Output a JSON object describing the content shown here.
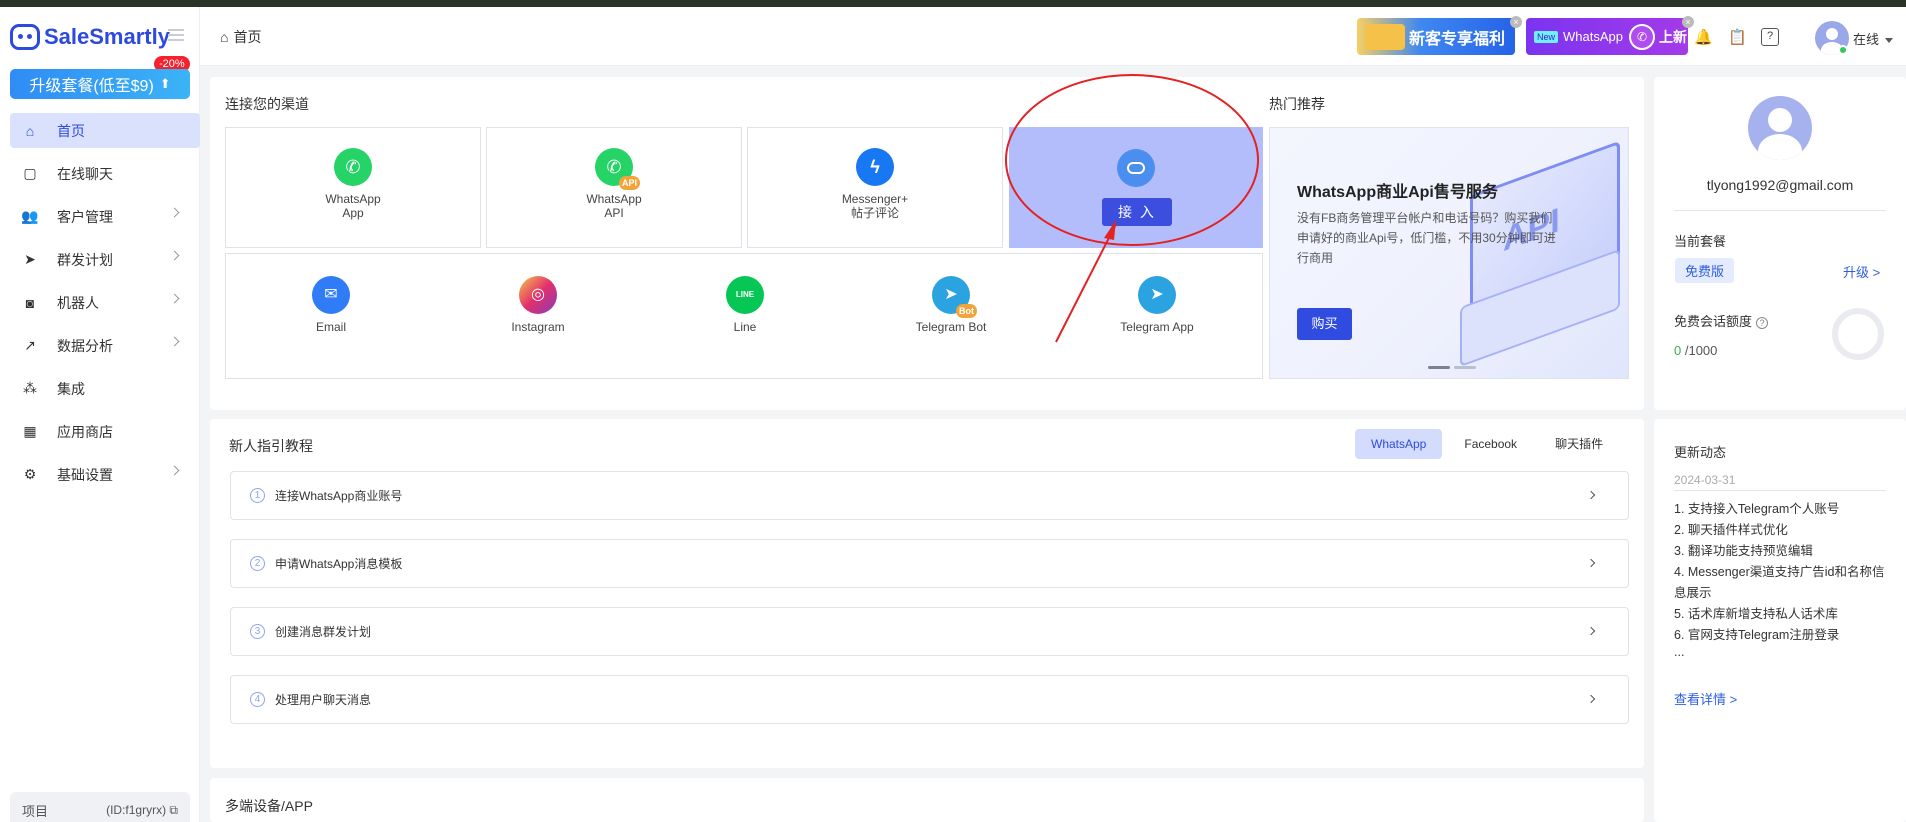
{
  "brand": {
    "name": "SaleSmartly"
  },
  "sidebar": {
    "upgrade_label": "升级套餐(低至$9)",
    "discount_badge": "-20%",
    "items": [
      {
        "label": "首页",
        "icon": "home-icon"
      },
      {
        "label": "在线聊天",
        "icon": "chat-icon"
      },
      {
        "label": "客户管理",
        "icon": "users-icon"
      },
      {
        "label": "群发计划",
        "icon": "send-icon"
      },
      {
        "label": "机器人",
        "icon": "robot-icon"
      },
      {
        "label": "数据分析",
        "icon": "chart-icon"
      },
      {
        "label": "集成",
        "icon": "integration-icon"
      },
      {
        "label": "应用商店",
        "icon": "apps-icon"
      },
      {
        "label": "基础设置",
        "icon": "gear-icon"
      }
    ],
    "project_label": "项目",
    "project_id": "(ID:f1gryrx)"
  },
  "header": {
    "breadcrumb": "首页",
    "promo_new_customer": "新客专享福利",
    "promo_new_tag": "New",
    "promo_whatsapp": "WhatsApp",
    "promo_launch": "上新",
    "status": "在线"
  },
  "channels": {
    "title": "连接您的渠道",
    "connect_button": "接 入",
    "row1": [
      {
        "line1": "WhatsApp",
        "line2": "App",
        "color": "#25D366"
      },
      {
        "line1": "WhatsApp",
        "line2": "API",
        "color": "#25D366",
        "badge": "API"
      },
      {
        "line1": "Messenger+",
        "line2": "帖子评论",
        "color": "#1877F2"
      }
    ],
    "row2": [
      {
        "label": "Email",
        "color": "#2f7cf6"
      },
      {
        "label": "Instagram",
        "color": "#e1306c"
      },
      {
        "label": "Line",
        "color": "#06c755"
      },
      {
        "label": "Telegram Bot",
        "color": "#2aa3e0",
        "badge": "Bot"
      },
      {
        "label": "Telegram App",
        "color": "#2aa3e0"
      }
    ]
  },
  "hot": {
    "title": "热门推荐",
    "banner_title": "WhatsApp商业Api售号服务",
    "banner_desc": "没有FB商务管理平台帐户和电话号码？购买我们申请好的商业Api号，低门槛，不用30分钟即可进行商用",
    "banner_button": "购买",
    "laptop_text": "API"
  },
  "profile": {
    "email": "tlyong1992@gmail.com",
    "plan_label": "当前套餐",
    "plan_value": "免费版",
    "upgrade_link": "升级 >",
    "quota_label": "免费会话额度",
    "quota_used": "0",
    "quota_total": " /1000",
    "quota_fraction": 0
  },
  "guide": {
    "title": "新人指引教程",
    "tabs": [
      "WhatsApp",
      "Facebook",
      "聊天插件"
    ],
    "steps": [
      {
        "num": "1",
        "label": "连接WhatsApp商业账号"
      },
      {
        "num": "2",
        "label": "申请WhatsApp消息模板"
      },
      {
        "num": "3",
        "label": "创建消息群发计划"
      },
      {
        "num": "4",
        "label": "处理用户聊天消息"
      }
    ]
  },
  "updates": {
    "title": "更新动态",
    "date": "2024-03-31",
    "items": [
      "1. 支持接入Telegram个人账号",
      "2. 聊天插件样式优化",
      "3. 翻译功能支持预览编辑",
      "4. Messenger渠道支持广告id和名称信息展示",
      "5. 话术库新增支持私人话术库",
      "6. 官网支持Telegram注册登录",
      "..."
    ],
    "more_link": "查看详情 >"
  },
  "devices": {
    "title": "多端设备/APP"
  },
  "colors": {
    "primary": "#2f4be0",
    "accent_light": "#d9e1fd",
    "annotation_red": "#e32222"
  }
}
